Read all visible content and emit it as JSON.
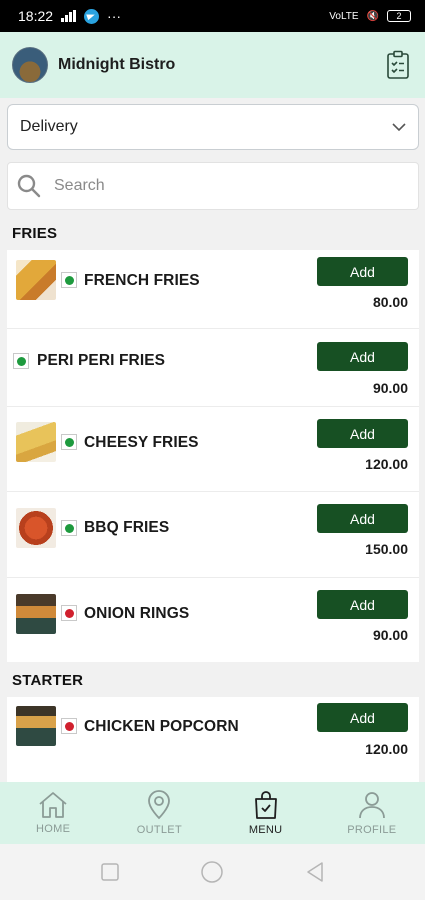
{
  "status_bar": {
    "time": "18:22",
    "extra": "···",
    "battery": "2"
  },
  "header": {
    "title": "Midnight Bistro"
  },
  "order_type": {
    "selected": "Delivery"
  },
  "search": {
    "placeholder": "Search"
  },
  "sections": [
    {
      "title": "FRIES",
      "items": [
        {
          "name": "FRENCH FRIES",
          "price": "80.00",
          "type": "veg",
          "has_image": true,
          "add_label": "Add"
        },
        {
          "name": "PERI PERI FRIES",
          "price": "90.00",
          "type": "veg",
          "has_image": false,
          "add_label": "Add"
        },
        {
          "name": "CHEESY FRIES",
          "price": "120.00",
          "type": "veg",
          "has_image": true,
          "add_label": "Add"
        },
        {
          "name": "BBQ FRIES",
          "price": "150.00",
          "type": "veg",
          "has_image": true,
          "add_label": "Add"
        },
        {
          "name": "ONION RINGS",
          "price": "90.00",
          "type": "non-veg",
          "has_image": true,
          "add_label": "Add"
        }
      ]
    },
    {
      "title": "STARTER",
      "items": [
        {
          "name": "CHICKEN POPCORN",
          "price": "120.00",
          "type": "non-veg",
          "has_image": true,
          "add_label": "Add"
        }
      ]
    }
  ],
  "bottom_nav": [
    {
      "label": "HOME",
      "icon": "home-icon",
      "active": false
    },
    {
      "label": "OUTLET",
      "icon": "location-pin-icon",
      "active": false
    },
    {
      "label": "MENU",
      "icon": "shopping-bag-icon",
      "active": true
    },
    {
      "label": "PROFILE",
      "icon": "user-icon",
      "active": false
    }
  ],
  "colors": {
    "accent": "#175023",
    "header_bg": "#d9f3e8",
    "veg": "#1e9a3e",
    "non_veg": "#d0202e"
  }
}
